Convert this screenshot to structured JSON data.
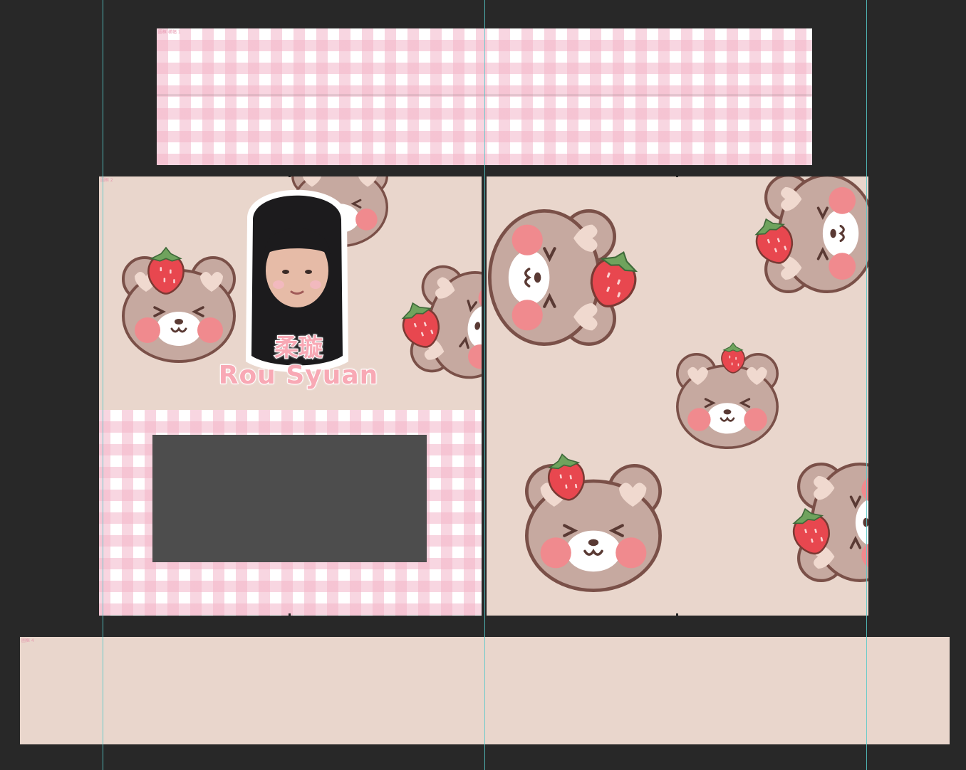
{
  "canvas": {
    "background": "#282828",
    "guide_color": "#56c9c9"
  },
  "artboards": {
    "top_banner_label": "圖框 橫幅 1",
    "left_panel_label": "圖框 2",
    "bottom_strip_label": "圖框 4"
  },
  "profile": {
    "name_cn": "柔璇",
    "name_en": "Rou Syuan"
  },
  "colors": {
    "gingham_pink": "#f3b4c8",
    "beige": "#e9d6cc",
    "bear_brown": "#c6a9a0",
    "bear_outline": "#7a5048",
    "cheek_pink": "#f08a8e",
    "strawberry_red": "#e8474f",
    "leaf_green": "#6fa35d",
    "placeholder_gray": "#4d4d4d"
  }
}
